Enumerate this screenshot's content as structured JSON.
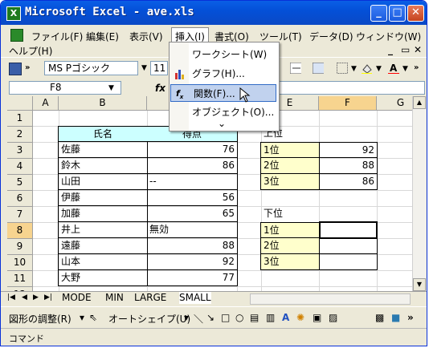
{
  "window": {
    "title": "Microsoft Excel - ave.xls",
    "app_icon": "X"
  },
  "menubar": {
    "items": [
      "ファイル(F)",
      "編集(E)",
      "表示(V)",
      "挿入(I)",
      "書式(O)",
      "ツール(T)",
      "データ(D)",
      "ウィンドウ(W)"
    ],
    "help": "ヘルプ(H)"
  },
  "insert_menu": {
    "items": [
      {
        "label": "ワークシート(W)",
        "icon": ""
      },
      {
        "label": "グラフ(H)...",
        "icon": "chart-icon"
      },
      {
        "label": "関数(F)...",
        "icon": "function-icon"
      },
      {
        "label": "オブジェクト(O)...",
        "icon": ""
      }
    ],
    "highlighted": "関数(F)...",
    "expand_glyph": "⌄"
  },
  "toolbar": {
    "font_name": "MS Pゴシック",
    "font_size": "11"
  },
  "formula_bar": {
    "name_box": "F8",
    "fx": "fx",
    "content": ""
  },
  "columns": [
    "A",
    "B",
    "C",
    "D",
    "E",
    "F",
    "G"
  ],
  "rows": [
    "1",
    "2",
    "3",
    "4",
    "5",
    "6",
    "7",
    "8",
    "9",
    "10",
    "11",
    "12",
    "13"
  ],
  "table": {
    "header_name": "氏名",
    "header_score": "得点",
    "records": [
      {
        "name": "佐藤",
        "score": "76"
      },
      {
        "name": "鈴木",
        "score": "86"
      },
      {
        "name": "山田",
        "score": "--"
      },
      {
        "name": "伊藤",
        "score": "56"
      },
      {
        "name": "加藤",
        "score": "65"
      },
      {
        "name": "井上",
        "score": "無効"
      },
      {
        "name": "遠藤",
        "score": "88"
      },
      {
        "name": "山本",
        "score": "92"
      },
      {
        "name": "大野",
        "score": "77"
      }
    ]
  },
  "upper": {
    "title": "上位",
    "rows": [
      {
        "rank": "1位",
        "value": "92"
      },
      {
        "rank": "2位",
        "value": "88"
      },
      {
        "rank": "3位",
        "value": "86"
      }
    ]
  },
  "lower": {
    "title": "下位",
    "rows": [
      {
        "rank": "1位",
        "value": ""
      },
      {
        "rank": "2位",
        "value": ""
      },
      {
        "rank": "3位",
        "value": ""
      }
    ]
  },
  "sheet_tabs": [
    "MODE",
    "MIN",
    "LARGE",
    "SMALL"
  ],
  "active_sheet": "SMALL",
  "drawbar": {
    "shape_adjust": "図形の調整(R)",
    "autoshape": "オートシェイプ(U)"
  },
  "status": "コマンド",
  "colors": {
    "header_fill": "#ccffff",
    "rank_fill": "#ffffcc",
    "selection": "#f7d48f"
  }
}
